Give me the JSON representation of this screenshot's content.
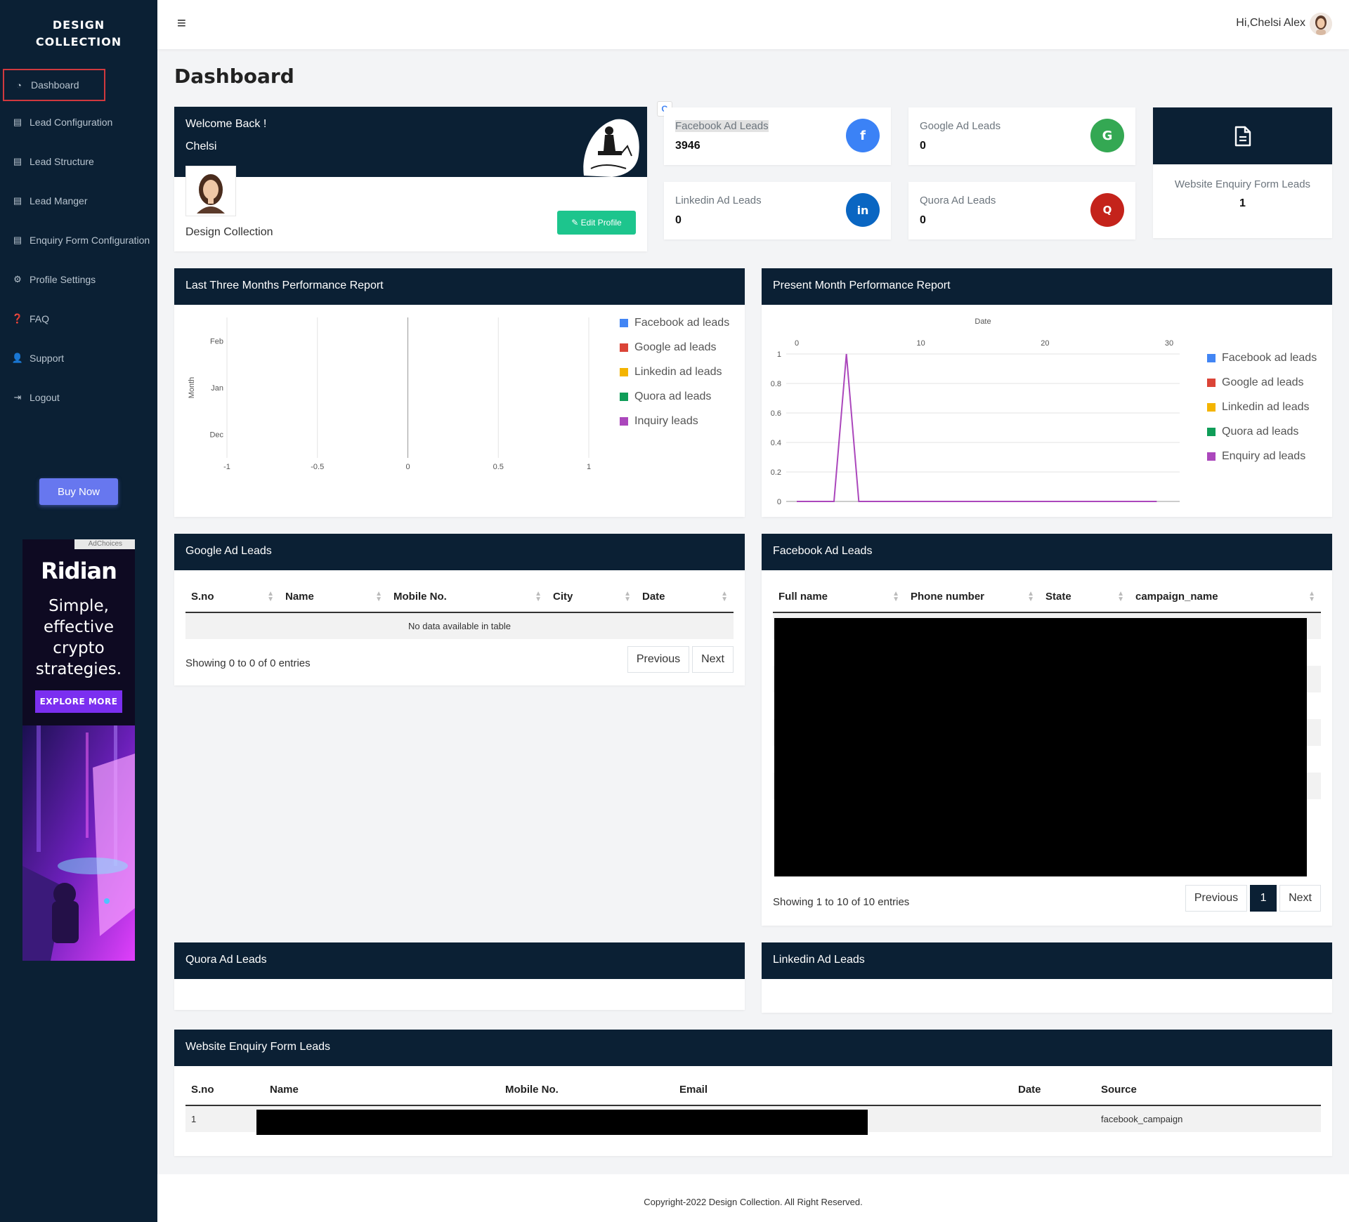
{
  "sidebar": {
    "brand_line1": "DESIGN",
    "brand_line2": "COLLECTION",
    "items": [
      {
        "label": "Dashboard",
        "icon": "gauge-icon"
      },
      {
        "label": "Lead Configuration",
        "icon": "file-icon"
      },
      {
        "label": "Lead Structure",
        "icon": "file-icon"
      },
      {
        "label": "Lead Manger",
        "icon": "file-icon"
      },
      {
        "label": "Enquiry Form Configuration",
        "icon": "file-icon"
      },
      {
        "label": "Profile Settings",
        "icon": "cogs-icon"
      },
      {
        "label": "FAQ",
        "icon": "question-icon"
      },
      {
        "label": "Support",
        "icon": "user-gear-icon"
      },
      {
        "label": "Logout",
        "icon": "logout-icon"
      }
    ],
    "buy_now": "Buy Now",
    "ad": {
      "choices": "AdChoices",
      "logo": "Ridian",
      "tagline": [
        "Simple,",
        "effective",
        "crypto",
        "strategies."
      ],
      "button": "EXPLORE MORE"
    }
  },
  "topbar": {
    "greeting": "Hi,Chelsi Alex"
  },
  "page_title": "Dashboard",
  "welcome": {
    "line1": "Welcome Back !",
    "line2": "Chelsi",
    "company": "Design Collection",
    "edit_button": "Edit Profile"
  },
  "stats": {
    "facebook": {
      "label": "Facebook Ad Leads",
      "value": "3946",
      "icon": "f",
      "color": "#3b82f6"
    },
    "google": {
      "label": "Google Ad Leads",
      "value": "0",
      "icon": "G",
      "color": "#34a853"
    },
    "linkedin": {
      "label": "Linkedin Ad Leads",
      "value": "0",
      "icon": "in",
      "color": "#0a66c2"
    },
    "quora": {
      "label": "Quora Ad Leads",
      "value": "0",
      "icon": "Q",
      "color": "#c4231b"
    },
    "website": {
      "label": "Website Enquiry Form Leads",
      "value": "1",
      "icon": "document-icon"
    }
  },
  "charts": {
    "three_months": {
      "title": "Last Three Months Performance Report",
      "legend": [
        "Facebook ad leads",
        "Google ad leads",
        "Linkedin ad leads",
        "Quora ad leads",
        "Inquiry leads"
      ]
    },
    "present_month": {
      "title": "Present Month Performance Report",
      "legend": [
        "Facebook ad leads",
        "Google ad leads",
        "Linkedin ad leads",
        "Quora ad leads",
        "Enquiry ad leads"
      ]
    }
  },
  "chart_data": [
    {
      "type": "bar",
      "orientation": "horizontal",
      "ylabel": "Month",
      "categories": [
        "Feb",
        "Jan",
        "Dec"
      ],
      "xlim": [
        -1,
        1
      ],
      "xticks": [
        "-1",
        "-0.5",
        "0",
        "0.5",
        "1"
      ],
      "series": [
        {
          "name": "Facebook ad leads",
          "color": "#4285f4",
          "values": [
            0,
            0,
            0
          ]
        },
        {
          "name": "Google ad leads",
          "color": "#db4437",
          "values": [
            0,
            0,
            0
          ]
        },
        {
          "name": "Linkedin ad leads",
          "color": "#f4b400",
          "values": [
            0,
            0,
            0
          ]
        },
        {
          "name": "Quora ad leads",
          "color": "#0f9d58",
          "values": [
            0,
            0,
            0
          ]
        },
        {
          "name": "Inquiry leads",
          "color": "#ab47bc",
          "values": [
            0,
            0,
            0
          ]
        }
      ],
      "legend": "right",
      "grid": true
    },
    {
      "type": "line",
      "xlabel": "Date",
      "xlim": [
        0,
        30
      ],
      "xticks": [
        "0",
        "10",
        "20",
        "30"
      ],
      "ylim": [
        0,
        1
      ],
      "yticks": [
        "0",
        "0.2",
        "0.4",
        "0.6",
        "0.8",
        "1"
      ],
      "series": [
        {
          "name": "Enquiry ad leads",
          "color": "#ab47bc",
          "x": [
            0,
            3,
            4,
            5,
            6,
            7,
            8,
            9,
            10,
            11,
            12,
            13,
            14,
            15,
            16,
            17,
            18,
            19,
            20,
            21,
            22,
            23,
            24,
            25,
            26,
            27,
            28,
            29
          ],
          "y": [
            0,
            0,
            1,
            0,
            0,
            0,
            0,
            0,
            0,
            0,
            0,
            0,
            0,
            0,
            0,
            0,
            0,
            0,
            0,
            0,
            0,
            0,
            0,
            0,
            0,
            0,
            0,
            0
          ]
        }
      ],
      "legend_colors": [
        "#4285f4",
        "#db4437",
        "#f4b400",
        "#0f9d58",
        "#ab47bc"
      ],
      "legend": "right",
      "grid": true
    }
  ],
  "google_table": {
    "title": "Google Ad Leads",
    "columns": [
      "S.no",
      "Name",
      "Mobile No.",
      "City",
      "Date"
    ],
    "empty": "No data available in table",
    "info": "Showing 0 to 0 of 0 entries",
    "prev": "Previous",
    "next": "Next"
  },
  "facebook_table": {
    "title": "Facebook Ad Leads",
    "columns": [
      "Full name",
      "Phone number",
      "State",
      "campaign_name"
    ],
    "info": "Showing 1 to 10 of 10 entries",
    "prev": "Previous",
    "page": "1",
    "next": "Next"
  },
  "quora_panel": {
    "title": "Quora Ad Leads"
  },
  "linkedin_panel": {
    "title": "Linkedin Ad Leads"
  },
  "website_table": {
    "title": "Website Enquiry Form Leads",
    "columns": [
      "S.no",
      "Name",
      "Mobile No.",
      "Email",
      "Date",
      "Source"
    ],
    "rows": [
      {
        "sno": "1",
        "source": "facebook_campaign"
      }
    ]
  },
  "footer": "Copyright-2022 Design Collection. All Right Reserved."
}
